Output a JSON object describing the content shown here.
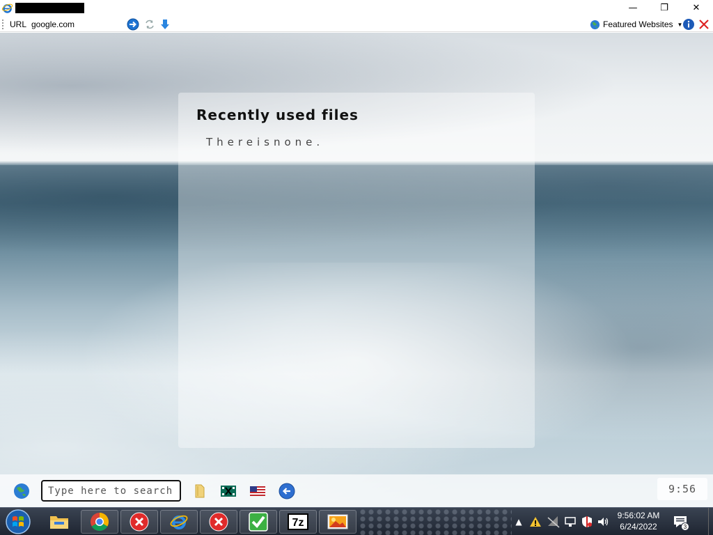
{
  "window": {
    "title_redacted": true,
    "minimize_glyph": "—",
    "restore_glyph": "❐",
    "close_glyph": "✕"
  },
  "toolbar": {
    "url_label": "URL",
    "url_value": "google.com",
    "featured_label": "Featured Websites",
    "icons": [
      "go-icon",
      "refresh-icon",
      "download-icon",
      "info-icon",
      "stop-icon"
    ]
  },
  "panel": {
    "title": "Recently used files",
    "empty_text": "Thereisnone."
  },
  "dock": {
    "search_placeholder": "Type here to search",
    "time": "9:56",
    "icons": [
      "globe-icon",
      "folder-icon",
      "film-icon",
      "us-flag-icon",
      "back-arrow-icon"
    ]
  },
  "taskbar": {
    "apps": [
      "start-orb",
      "file-explorer",
      "chrome",
      "error-app",
      "internet-explorer",
      "error-app",
      "checkmark-app",
      "7zip",
      "image-viewer"
    ],
    "clock_time": "9:56:02 AM",
    "clock_date": "6/24/2022",
    "notification_count": "3"
  },
  "colors": {
    "accent_blue": "#1e73d2",
    "error_red": "#e02b2b",
    "check_green": "#3cb043",
    "taskbar": "#2a3140"
  }
}
